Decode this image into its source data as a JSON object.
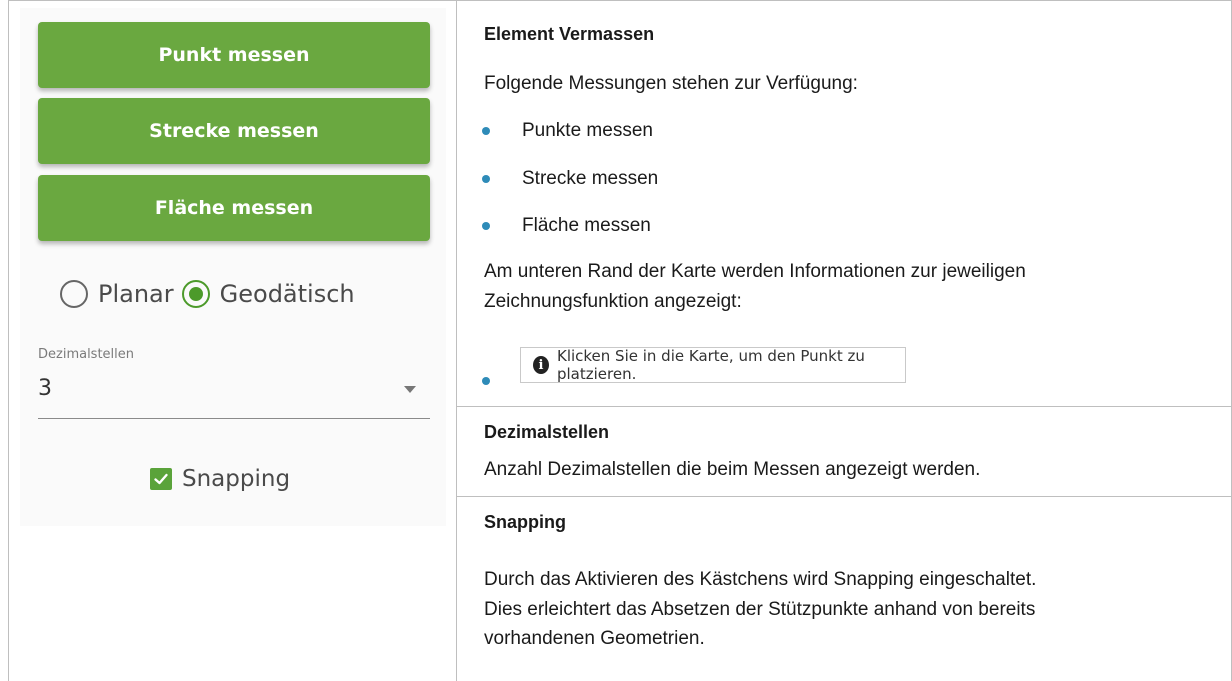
{
  "widget": {
    "buttons": [
      {
        "label": "Punkt messen"
      },
      {
        "label": "Strecke messen"
      },
      {
        "label": "Fläche messen"
      }
    ],
    "mode": {
      "options": [
        {
          "label": "Planar",
          "selected": false
        },
        {
          "label": "Geodätisch",
          "selected": true
        }
      ]
    },
    "decimals": {
      "label": "Dezimalstellen",
      "value": "3"
    },
    "snapping": {
      "label": "Snapping",
      "checked": true
    },
    "accent_color": "#6aa840"
  },
  "doc": {
    "section1": {
      "title": "Element Vermassen",
      "intro": "Folgende Messungen stehen zur Verfügung:",
      "items": [
        "Punkte messen",
        "Strecke messen",
        "Fläche messen"
      ],
      "info_line1": "Am unteren Rand der Karte werden Informationen zur jeweiligen",
      "info_line2": "Zeichnungsfunktion angezeigt:",
      "hint": "Klicken Sie in die Karte, um den Punkt zu platzieren."
    },
    "section2": {
      "title": "Dezimalstellen",
      "text": "Anzahl Dezimalstellen die beim Messen angezeigt werden."
    },
    "section3": {
      "title": "Snapping",
      "line1": "Durch das Aktivieren des Kästchens wird Snapping eingeschaltet.",
      "line2": "Dies erleichtert das Absetzen der Stützpunkte anhand von bereits",
      "line3": "vorhandenen Geometrien."
    },
    "bullet_color": "#2e8bb8"
  }
}
